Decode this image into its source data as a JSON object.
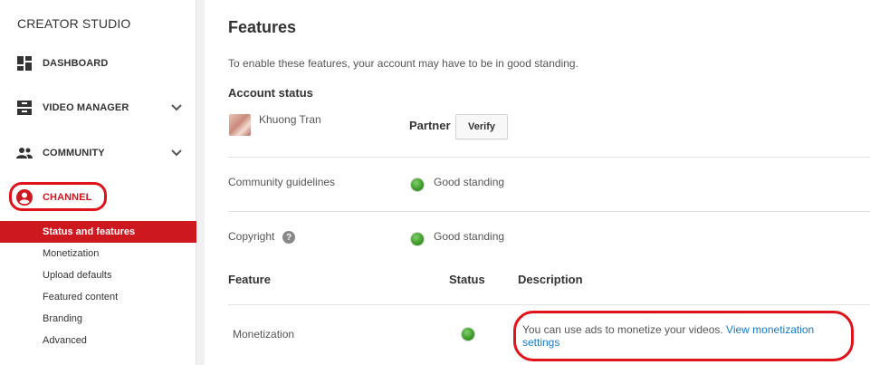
{
  "sidebar": {
    "title": "CREATOR STUDIO",
    "items": [
      {
        "label": "DASHBOARD",
        "icon": "dashboard-icon"
      },
      {
        "label": "VIDEO MANAGER",
        "icon": "video-manager-icon"
      },
      {
        "label": "COMMUNITY",
        "icon": "community-icon"
      },
      {
        "label": "CHANNEL",
        "icon": "channel-icon"
      }
    ],
    "channel_sub": [
      {
        "label": "Status and features",
        "active": true
      },
      {
        "label": "Monetization"
      },
      {
        "label": "Upload defaults"
      },
      {
        "label": "Featured content"
      },
      {
        "label": "Branding"
      },
      {
        "label": "Advanced"
      }
    ]
  },
  "main": {
    "title": "Features",
    "intro": "To enable these features, your account may have to be in good standing.",
    "account_status": {
      "heading": "Account status",
      "user_name": "Khuong Tran",
      "partner_label": "Partner",
      "verify_label": "Verify"
    },
    "standing_rows": [
      {
        "label": "Community guidelines",
        "status": "Good standing"
      },
      {
        "label": "Copyright",
        "status": "Good standing"
      }
    ],
    "table": {
      "headers": [
        "Feature",
        "Status",
        "Description"
      ],
      "rows": [
        {
          "feature": "Monetization",
          "description_text": "You can use ads to monetize your videos.",
          "description_link": "View monetization settings"
        }
      ]
    }
  },
  "colors": {
    "accent": "#cc181e",
    "highlight_oval": "#e0131a",
    "link": "#167ac6",
    "status_green": "#3f9d2a"
  }
}
